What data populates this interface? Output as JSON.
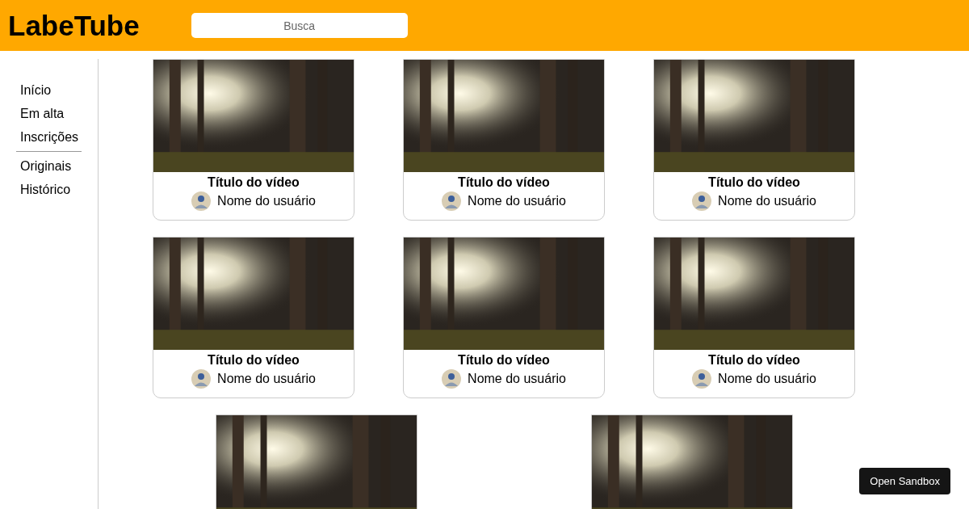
{
  "header": {
    "logo": "LabeTube",
    "search": {
      "placeholder": "Busca"
    }
  },
  "sidebar": {
    "groups": [
      {
        "items": [
          "Início",
          "Em alta",
          "Inscrições"
        ]
      },
      {
        "items": [
          "Originais",
          "Histórico"
        ]
      }
    ]
  },
  "videos": [
    {
      "kind": "full",
      "title": "Título do vídeo",
      "user": "Nome do usuário"
    },
    {
      "kind": "full",
      "title": "Título do vídeo",
      "user": "Nome do usuário"
    },
    {
      "kind": "full",
      "title": "Título do vídeo",
      "user": "Nome do usuário"
    },
    {
      "kind": "full",
      "title": "Título do vídeo",
      "user": "Nome do usuário"
    },
    {
      "kind": "full",
      "title": "Título do vídeo",
      "user": "Nome do usuário"
    },
    {
      "kind": "full",
      "title": "Título do vídeo",
      "user": "Nome do usuário"
    },
    {
      "kind": "cut_off"
    },
    {
      "kind": "cut_off"
    }
  ],
  "sandbox_button": "Open Sandbox"
}
